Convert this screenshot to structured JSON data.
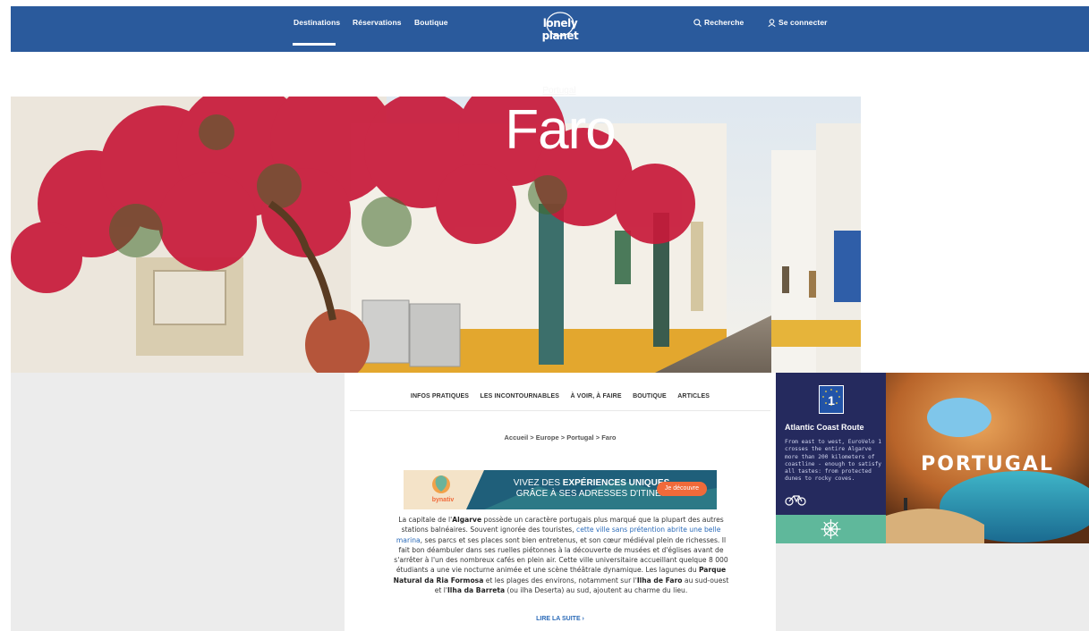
{
  "nav": {
    "destinations": "Destinations",
    "reservations": "Réservations",
    "boutique": "Boutique",
    "logo": "lonely planet",
    "search": "Recherche",
    "login": "Se connecter"
  },
  "hero": {
    "country": "Portugal",
    "title": "Faro"
  },
  "subnav": {
    "items": [
      "INFOS PRATIQUES",
      "LES INCONTOURNABLES",
      "À VOIR, À FAIRE",
      "BOUTIQUE",
      "ARTICLES"
    ]
  },
  "breadcrumb": {
    "items": [
      "Accueil",
      "Europe",
      "Portugal",
      "Faro"
    ],
    "separator": ">"
  },
  "banner": {
    "line1_a": "VIVEZ DES ",
    "line1_b": "EXPÉRIENCES UNIQUES",
    "line2": "GRÂCE À SES ADRESSES D'ITINÉS",
    "button": "Je découvre",
    "brand": "bynativ"
  },
  "intro": {
    "p1": "La capitale de l'",
    "algarve": "Algarve",
    "p2": " possède un caractère portugais plus marqué que la plupart des autres stations balnéaires. Souvent ignorée des touristes, ",
    "link": "cette ville sans prétention abrite une belle marina",
    "p3": ", ses parcs et ses places sont bien entretenus, et son cœur médiéval plein de richesses. Il fait bon déambuler dans ses ruelles piétonnes à la découverte de musées et d'églises avant de s'arrêter à l'un des nombreux cafés en plein air. Cette ville universitaire accueillant quelque 8 000 étudiants a une vie nocturne animée et une scène théâtrale dynamique. Les lagunes du ",
    "ria": "Parque Natural da Ria Formosa",
    "p4": " et les plages des environs, notamment sur l'",
    "faro": "Ilha de Faro",
    "p5": " au sud-ouest et l'",
    "barreta": "Ilha da Barreta",
    "p6": " (ou ilha Deserta) au sud, ajoutent au charme du lieu.",
    "read_more": "LIRE LA SUITE ›"
  },
  "ad1": {
    "badge": "1",
    "title": "Atlantic Coast Route",
    "body": "From east to west, EuroVelo 1 crosses the entire Algarve more than 200 kilometers of coastline - enough to satisfy all tastes: from protected dunes to rocky coves."
  },
  "ad2": {
    "text": "PORTUGAL"
  },
  "colors": {
    "nav_bg": "#2a5a9c",
    "link": "#2a6ab8",
    "ad1_bg": "#252a5e",
    "ad1_footer": "#5fb89b"
  }
}
